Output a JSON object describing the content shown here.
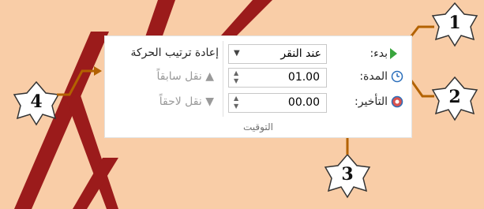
{
  "ribbon": {
    "start_label": "بدء:",
    "start_value": "عند النقر",
    "duration_label": "المدة:",
    "duration_value": "01.00",
    "delay_label": "التأخير:",
    "delay_value": "00.00",
    "reorder_title": "إعادة ترتيب الحركة",
    "move_earlier": "نقل سابقاً",
    "move_later": "نقل لاحقاً",
    "group_caption": "التوقيت"
  },
  "callouts": {
    "c1": "1",
    "c2": "2",
    "c3": "3",
    "c4": "4"
  },
  "colors": {
    "background": "#f9cda7",
    "arrow": "#b36200",
    "stripe": "#9b1b1b",
    "start_icon": "#39a53d"
  }
}
